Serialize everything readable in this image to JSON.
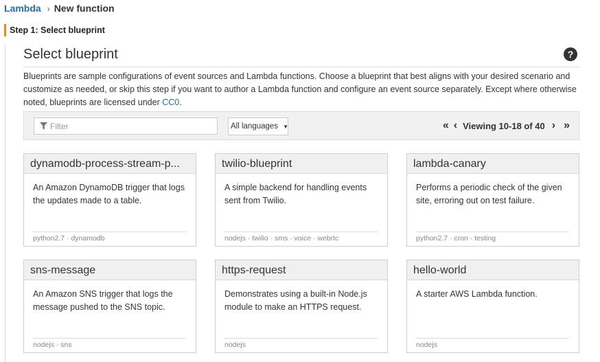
{
  "breadcrumb": {
    "root": "Lambda",
    "separator": "›",
    "current": "New function"
  },
  "step": {
    "label": "Step 1: Select blueprint"
  },
  "main": {
    "title": "Select blueprint",
    "help_glyph": "?",
    "help_icon": "question-circle-icon",
    "description": "Blueprints are sample configurations of event sources and Lambda functions. Choose a blueprint that best aligns with your desired scenario and customize as needed, or skip this step if you want to author a Lambda function and configure an event source separately. Except where otherwise noted, blueprints are licensed under ",
    "license_link": "CC0",
    "description_end": "."
  },
  "toolbar": {
    "filter_placeholder": "Filter",
    "filter_value": "",
    "filter_icon": "funnel-icon",
    "language_select": "All languages",
    "caret": "▼",
    "pager": {
      "first": "«",
      "prev": "‹",
      "viewing": "Viewing 10-18 of 40",
      "next": "›",
      "last": "»"
    }
  },
  "blueprints": [
    {
      "title": "dynamodb-process-stream-p...",
      "description": "An Amazon DynamoDB trigger that logs the updates made to a table.",
      "tags": "python2.7 · dynamodb"
    },
    {
      "title": "twilio-blueprint",
      "description": "A simple backend for handling events sent from Twilio.",
      "tags": "nodejs · twilio · sms · voice · webrtc"
    },
    {
      "title": "lambda-canary",
      "description": "Performs a periodic check of the given site, erroring out on test failure.",
      "tags": "python2.7 · cron · testing"
    },
    {
      "title": "sns-message",
      "description": "An Amazon SNS trigger that logs the message pushed to the SNS topic.",
      "tags": "nodejs · sns"
    },
    {
      "title": "https-request",
      "description": "Demonstrates using a built-in Node.js module to make an HTTPS request.",
      "tags": "nodejs"
    },
    {
      "title": "hello-world",
      "description": "A starter AWS Lambda function.",
      "tags": "nodejs"
    }
  ],
  "colors": {
    "link": "#1f6fb0",
    "step_accent": "#ec8a19",
    "toolbar_bg": "#f1f1f1",
    "card_header_bg": "#f0f0f0"
  }
}
